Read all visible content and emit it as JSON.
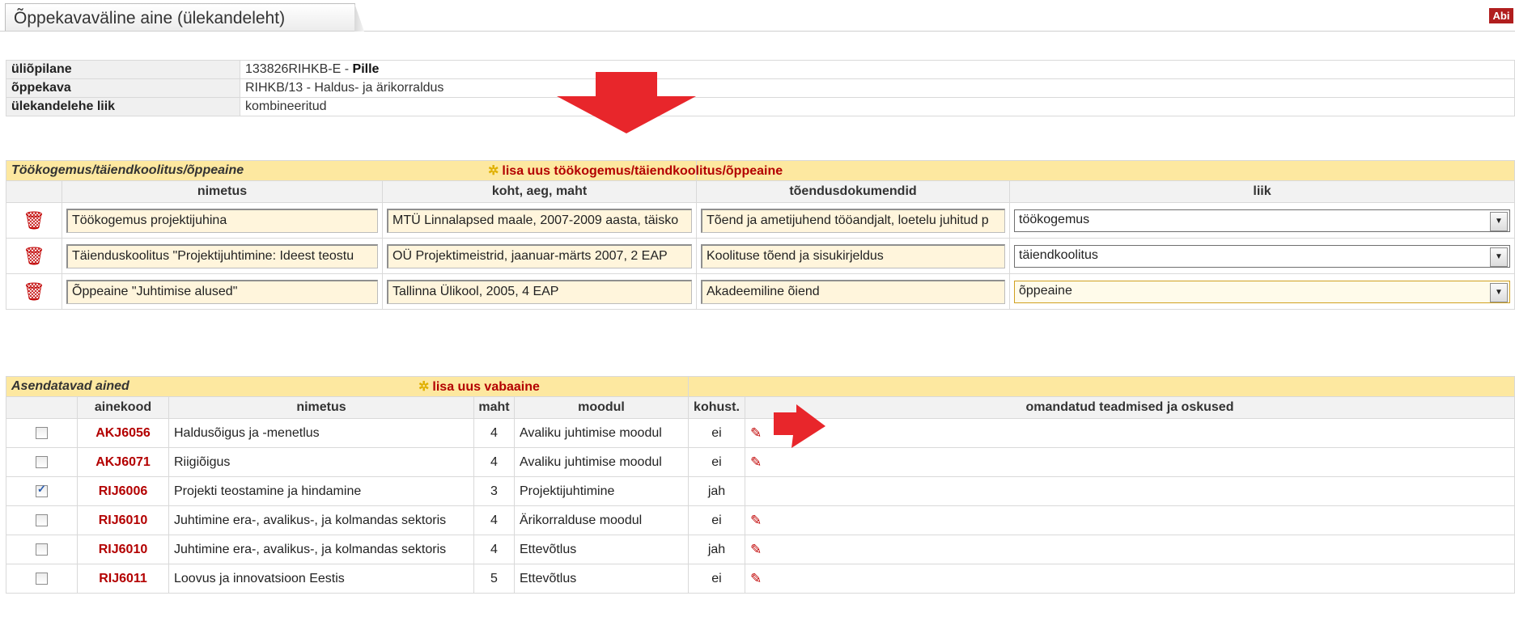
{
  "header": {
    "title": "Õppekavaväline aine (ülekandeleht)",
    "help_label": "Abi"
  },
  "info": {
    "student_label": "üliõpilane",
    "student_code": "133826RIHKB-E - ",
    "student_name": "Pille",
    "curriculum_label": "õppekava",
    "curriculum_value": "RIHKB/13 - Haldus- ja ärikorraldus",
    "sheet_type_label": "ülekandelehe liik",
    "sheet_type_value": "kombineeritud"
  },
  "experience": {
    "section_title": "Töökogemus/täiendkoolitus/õppeaine",
    "add_label": "lisa uus töökogemus/täiendkoolitus/õppeaine",
    "columns": [
      "nimetus",
      "koht, aeg, maht",
      "tõendusdokumendid",
      "liik"
    ],
    "rows": [
      {
        "name": "Töökogemus projektijuhina",
        "place": "MTÜ Linnalapsed maale, 2007-2009 aasta, täisko",
        "docs": "Tõend ja ametijuhend tööandjalt, loetelu juhitud p",
        "type": "töökogemus"
      },
      {
        "name": "Täienduskoolitus \"Projektijuhtimine: Ideest teostu",
        "place": "OÜ Projektimeistrid, jaanuar-märts 2007, 2 EAP",
        "docs": "Koolituse tõend ja sisukirjeldus",
        "type": "täiendkoolitus"
      },
      {
        "name": "Õppeaine \"Juhtimise alused\"",
        "place": "Tallinna Ülikool, 2005, 4 EAP",
        "docs": "Akadeemiline õiend",
        "type": "õppeaine"
      }
    ]
  },
  "courses": {
    "section_title": "Asendatavad ained",
    "add_label": "lisa uus vabaaine",
    "columns": [
      "ainekood",
      "nimetus",
      "maht",
      "moodul",
      "kohust.",
      "omandatud teadmised ja oskused"
    ],
    "rows": [
      {
        "checked": false,
        "code": "AKJ6056",
        "name": "Haldusõigus ja -menetlus",
        "credits": "4",
        "module": "Avaliku juhtimise moodul",
        "mandatory": "ei"
      },
      {
        "checked": false,
        "code": "AKJ6071",
        "name": "Riigiõigus",
        "credits": "4",
        "module": "Avaliku juhtimise moodul",
        "mandatory": "ei"
      },
      {
        "checked": true,
        "code": "RIJ6006",
        "name": "Projekti teostamine ja hindamine",
        "credits": "3",
        "module": "Projektijuhtimine",
        "mandatory": "jah"
      },
      {
        "checked": false,
        "code": "RIJ6010",
        "name": "Juhtimine era-, avalikus-, ja kolmandas sektoris",
        "credits": "4",
        "module": "Ärikorralduse moodul",
        "mandatory": "ei"
      },
      {
        "checked": false,
        "code": "RIJ6010",
        "name": "Juhtimine era-, avalikus-, ja kolmandas sektoris",
        "credits": "4",
        "module": "Ettevõtlus",
        "mandatory": "jah"
      },
      {
        "checked": false,
        "code": "RIJ6011",
        "name": "Loovus ja innovatsioon Eestis",
        "credits": "5",
        "module": "Ettevõtlus",
        "mandatory": "ei"
      }
    ]
  },
  "colors": {
    "accent_red": "#b30000",
    "section_bg": "#fde8a0",
    "arrow_red": "#e8262b"
  },
  "icons": {
    "delete": "trash-icon",
    "edit": "pencil-icon",
    "add": "wand-icon",
    "dropdown": "chevron-down-icon"
  }
}
